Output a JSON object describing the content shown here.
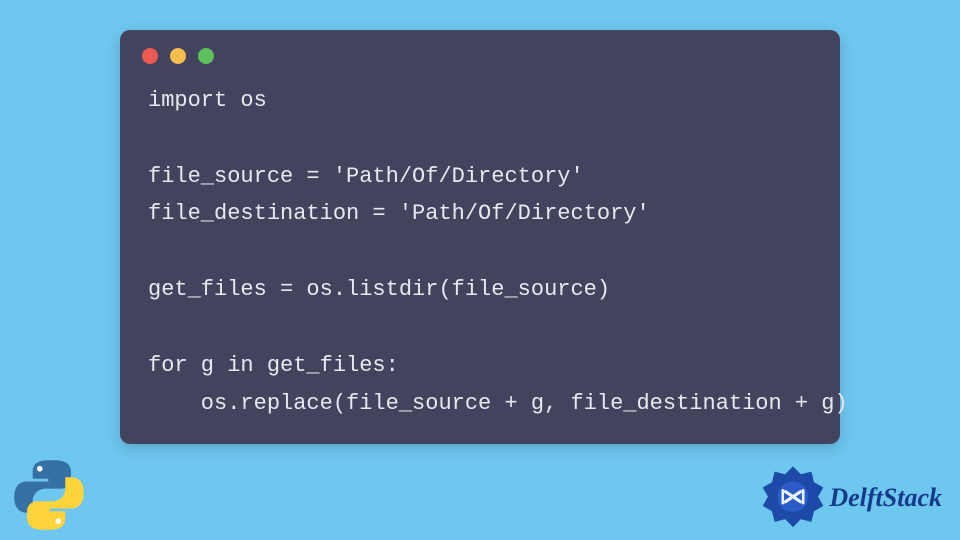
{
  "code": {
    "lines": [
      "import os",
      "",
      "file_source = 'Path/Of/Directory'",
      "file_destination = 'Path/Of/Directory'",
      "",
      "get_files = os.listdir(file_source)",
      "",
      "for g in get_files:",
      "    os.replace(file_source + g, file_destination + g)"
    ]
  },
  "branding": {
    "site_name": "DelftStack"
  },
  "colors": {
    "background": "#6ec7ef",
    "window": "#41445c",
    "code_text": "#e7e9f0",
    "dot_red": "#ec5a54",
    "dot_yellow": "#f4bd4d",
    "dot_green": "#5dc05d",
    "brand_text": "#153a8a"
  }
}
